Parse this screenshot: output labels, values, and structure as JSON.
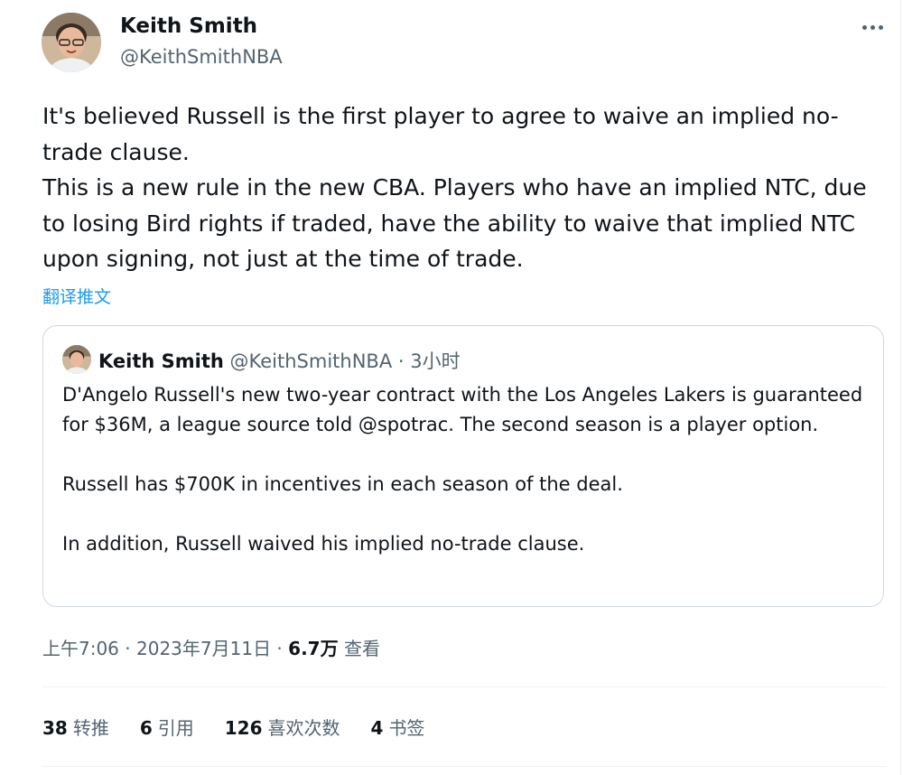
{
  "author": {
    "name": "Keith Smith",
    "handle": "@KeithSmithNBA"
  },
  "tweet": {
    "paragraphs": [
      "It's believed Russell is the first player to agree to waive an implied no-trade clause.",
      "This is a new rule in the new CBA. Players who have an implied NTC, due to losing Bird rights if traded, have the ability to waive that implied NTC upon signing, not just at the time of trade."
    ],
    "translate_label": "翻译推文"
  },
  "quoted": {
    "name": "Keith Smith",
    "handle": "@KeithSmithNBA",
    "separator": " · ",
    "time": "3小时",
    "paragraphs": [
      "D'Angelo Russell's new two-year contract with the Los Angeles Lakers is guaranteed for $36M, a league source told @spotrac. The second season is a player option.",
      "Russell has $700K in incentives in each season of the deal.",
      "In addition, Russell waived his implied no-trade clause."
    ]
  },
  "meta": {
    "time": "上午7:06",
    "dot": " · ",
    "date": "2023年7月11日",
    "views_count": "6.7万",
    "views_label": "查看"
  },
  "stats": {
    "retweets_count": "38",
    "retweets_label": "转推",
    "quotes_count": "6",
    "quotes_label": "引用",
    "likes_count": "126",
    "likes_label": "喜欢次数",
    "bookmarks_count": "4",
    "bookmarks_label": "书签"
  },
  "icons": {
    "more": "more-horizontal-icon",
    "avatar": "profile-photo"
  },
  "colors": {
    "link": "#1d9bf0",
    "text": "#0f1419",
    "secondary": "#536471",
    "border": "#cfd9de"
  }
}
